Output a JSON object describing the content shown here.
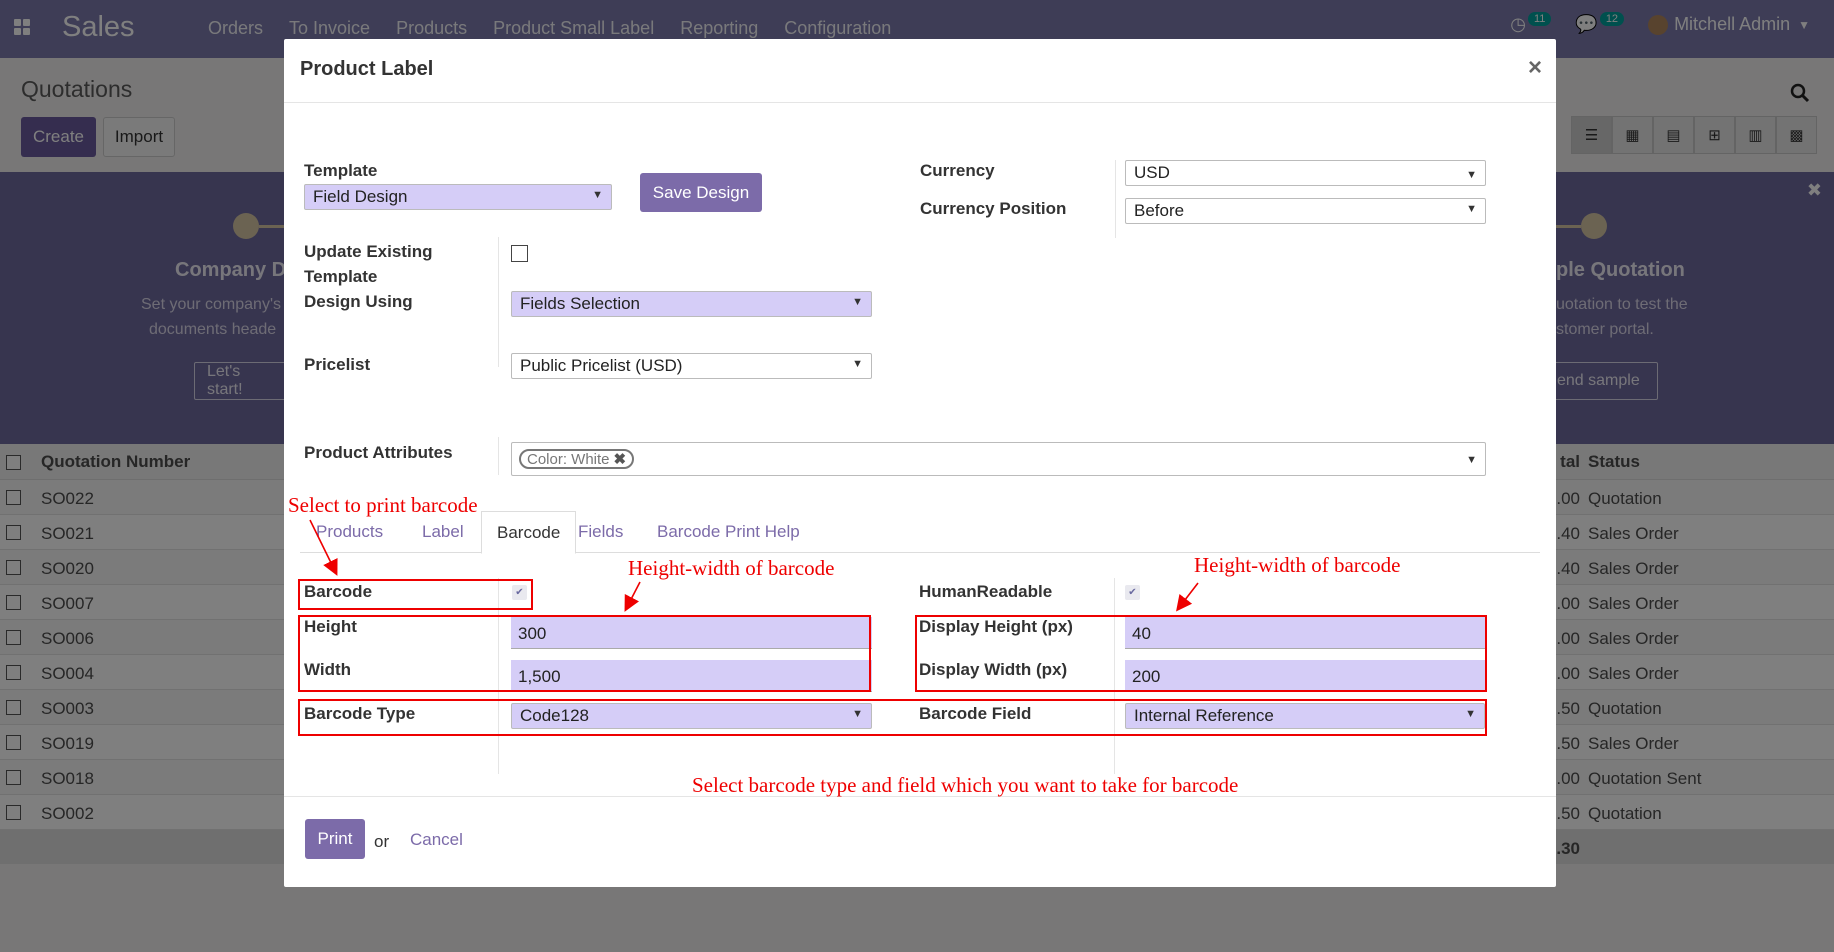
{
  "navbar": {
    "brand": "Sales",
    "menu": [
      "Orders",
      "To Invoice",
      "Products",
      "Product Small Label",
      "Reporting",
      "Configuration"
    ],
    "activity_count": "11",
    "message_count": "12",
    "user": "Mitchell Admin"
  },
  "control_panel": {
    "title": "Quotations",
    "create_label": "Create",
    "import_label": "Import"
  },
  "banner": {
    "left_title": "Company D",
    "left_text_1": "Set your company's",
    "left_text_2": "documents heade",
    "left_button": "Let's start!",
    "right_title": "ple Quotation",
    "right_text_1": "uotation to test the",
    "right_text_2": "stomer portal.",
    "right_button": "end sample"
  },
  "list": {
    "header_number": "Quotation Number",
    "header_total": "tal",
    "header_status": "Status",
    "rows": [
      {
        "number": "SO022",
        "total": ".00",
        "status": "Quotation"
      },
      {
        "number": "SO021",
        "total": ".40",
        "status": "Sales Order"
      },
      {
        "number": "SO020",
        "total": ".40",
        "status": "Sales Order"
      },
      {
        "number": "SO007",
        "total": ".00",
        "status": "Sales Order"
      },
      {
        "number": "SO006",
        "total": ".00",
        "status": "Sales Order"
      },
      {
        "number": "SO004",
        "total": ".00",
        "status": "Sales Order"
      },
      {
        "number": "SO003",
        "total": ".50",
        "status": "Quotation"
      },
      {
        "number": "SO019",
        "total": ".50",
        "status": "Sales Order"
      },
      {
        "number": "SO018",
        "total": ".00",
        "status": "Quotation Sent"
      },
      {
        "number": "SO002",
        "total": ".50",
        "status": "Quotation"
      }
    ],
    "footer_total": ".30"
  },
  "modal": {
    "title": "Product Label",
    "close": "×",
    "template_label": "Template",
    "template_value": "Field Design",
    "save_design_label": "Save Design",
    "currency_label": "Currency",
    "currency_value": "USD",
    "currency_position_label": "Currency Position",
    "currency_position_value": "Before",
    "update_template_label_1": "Update Existing",
    "update_template_label_2": "Template",
    "design_using_label": "Design Using",
    "design_using_value": "Fields Selection",
    "pricelist_label": "Pricelist",
    "pricelist_value": "Public Pricelist (USD)",
    "attributes_label": "Product Attributes",
    "attribute_tag": "Color: White",
    "tabs": [
      "Products",
      "Label",
      "Barcode",
      "Fields",
      "Barcode Print Help"
    ],
    "barcode_label": "Barcode",
    "human_readable_label": "HumanReadable",
    "height_label": "Height",
    "height_value": "300",
    "width_label": "Width",
    "width_value": "1,500",
    "display_height_label": "Display Height (px)",
    "display_height_value": "40",
    "display_width_label": "Display Width (px)",
    "display_width_value": "200",
    "barcode_type_label": "Barcode Type",
    "barcode_type_value": "Code128",
    "barcode_field_label": "Barcode Field",
    "barcode_field_value": "Internal Reference",
    "print_label": "Print",
    "or_text": "or",
    "cancel_label": "Cancel"
  },
  "annotations": {
    "select_print": "Select to print barcode",
    "hw_left": "Height-width of barcode",
    "hw_right": "Height-width of barcode",
    "select_type": "Select barcode type and field which you want to take for barcode"
  },
  "colors": {
    "brand": "#7c7bad",
    "primary_button": "#7c6ba9",
    "field_bg": "#d5cdf7",
    "annotation": "#ee0000"
  }
}
